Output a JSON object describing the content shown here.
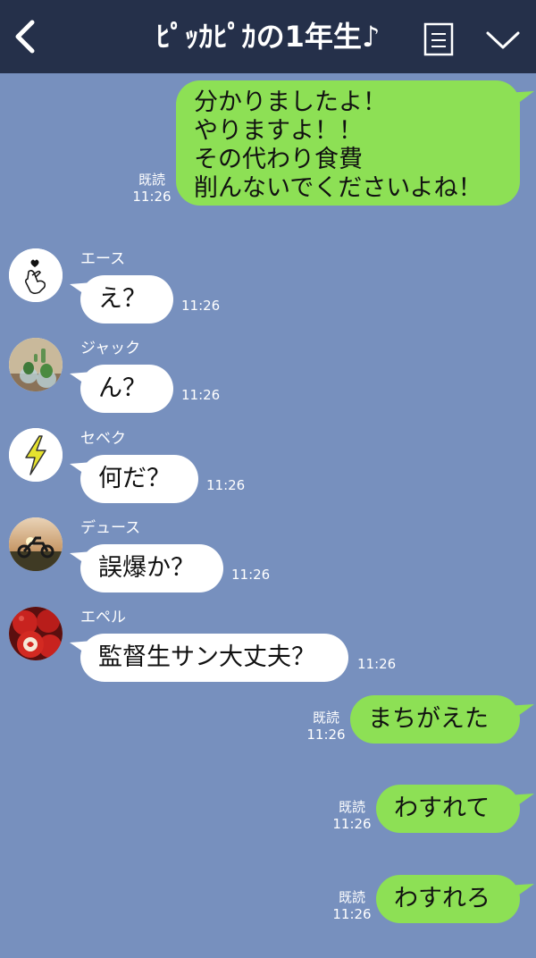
{
  "header": {
    "title": "ﾋﾟｯｶﾋﾟｶの1年生♪",
    "back_icon": "chevron-left-icon",
    "menu_icon": "list-icon",
    "collapse_icon": "chevron-down-icon",
    "bg_color": "#25304a"
  },
  "theme": {
    "chat_bg": "#7790be",
    "outgoing_bubble": "#8de055",
    "incoming_bubble": "#ffffff"
  },
  "messages": [
    {
      "side": "out",
      "text": "分かりましたよ！\nやりますよ！！\nその代わり食費\n削んないでくださいよね！",
      "read": "既読",
      "time": "11:26"
    },
    {
      "side": "in",
      "sender": "エース",
      "avatar": "finger-heart-icon",
      "text": "え？",
      "time": "11:26"
    },
    {
      "side": "in",
      "sender": "ジャック",
      "avatar": "cactus-photo",
      "text": "ん？",
      "time": "11:26"
    },
    {
      "side": "in",
      "sender": "セベク",
      "avatar": "lightning-icon",
      "text": "何だ？",
      "time": "11:26"
    },
    {
      "side": "in",
      "sender": "デュース",
      "avatar": "motorcycle-sunset-photo",
      "text": "誤爆か？",
      "time": "11:26"
    },
    {
      "side": "in",
      "sender": "エペル",
      "avatar": "apples-photo",
      "text": "監督生サン大丈夫？",
      "time": "11:26"
    },
    {
      "side": "out",
      "text": "まちがえた",
      "read": "既読",
      "time": "11:26"
    },
    {
      "side": "out",
      "text": "わすれて",
      "read": "既読",
      "time": "11:26"
    },
    {
      "side": "out",
      "text": "わすれろ",
      "read": "既読",
      "time": "11:26"
    }
  ]
}
